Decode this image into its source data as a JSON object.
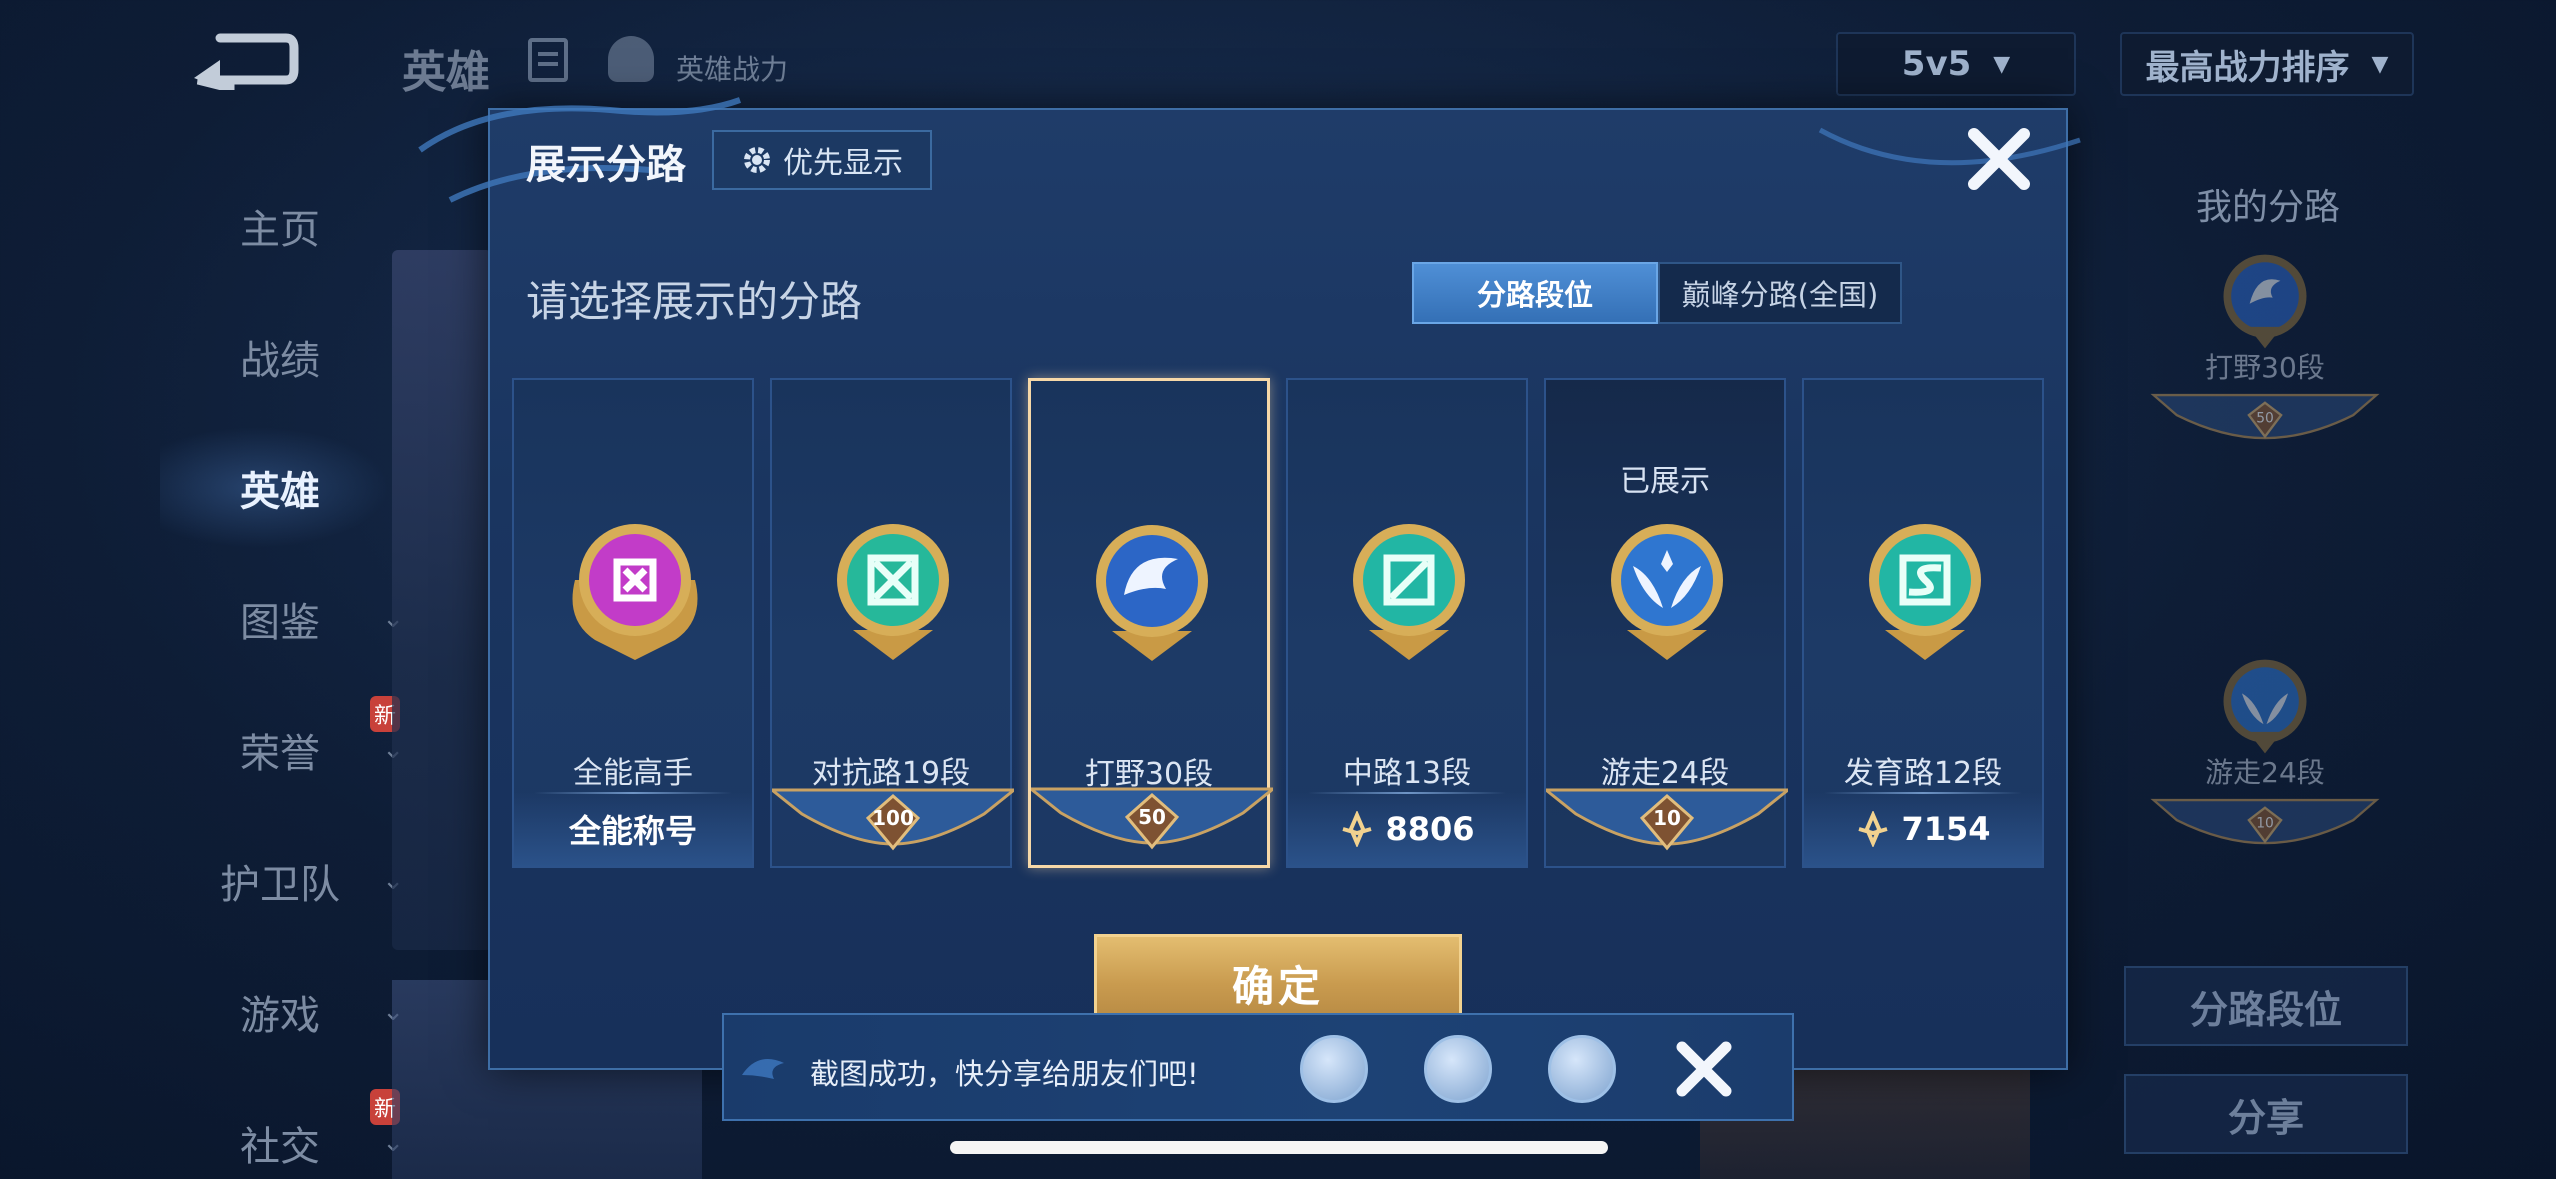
{
  "header": {
    "title": "英雄",
    "power_label": "英雄战力",
    "mode_select": "5v5",
    "sort_select": "最高战力排序"
  },
  "sidebar": {
    "items": [
      {
        "label": "主页"
      },
      {
        "label": "战绩"
      },
      {
        "label": "英雄"
      },
      {
        "label": "图鉴"
      },
      {
        "label": "荣誉",
        "badge": "新"
      },
      {
        "label": "护卫队"
      },
      {
        "label": "游戏"
      },
      {
        "label": "社交",
        "badge": "新"
      }
    ]
  },
  "right_panel": {
    "title": "我的分路",
    "entries": [
      {
        "label": "打野30段",
        "rank": "50"
      },
      {
        "label": "游走24段",
        "rank": "10"
      }
    ],
    "lane_rank_button": "分路段位",
    "share_button": "分享"
  },
  "modal": {
    "title": "展示分路",
    "priority_button": "优先显示",
    "prompt": "请选择展示的分路",
    "tabs": [
      {
        "label": "分路段位",
        "active": true
      },
      {
        "label": "巅峰分路(全国)",
        "active": false
      }
    ],
    "cards": [
      {
        "name": "全能高手",
        "footer": "全能称号",
        "emblem_color": "#c23cc8"
      },
      {
        "name": "对抗路19段",
        "rank": "100",
        "emblem_color": "#26b89a"
      },
      {
        "name": "打野30段",
        "rank": "50",
        "emblem_color": "#2c66c6",
        "selected": true
      },
      {
        "name": "中路13段",
        "points": "8806",
        "emblem_color": "#22b6a4"
      },
      {
        "name": "游走24段",
        "rank": "10",
        "status": "已展示",
        "emblem_color": "#2f76d0"
      },
      {
        "name": "发育路12段",
        "points": "7154",
        "emblem_color": "#22b6a4"
      }
    ],
    "confirm_button": "确定"
  },
  "share_bar": {
    "message": "截图成功，快分享给朋友们吧!",
    "icons": [
      "qq-icon",
      "wechat-icon",
      "qzone-icon"
    ]
  },
  "colors": {
    "accent_gold": "#f2d28f",
    "panel_blue": "#1a3560",
    "tab_active": "#3f80c8"
  }
}
